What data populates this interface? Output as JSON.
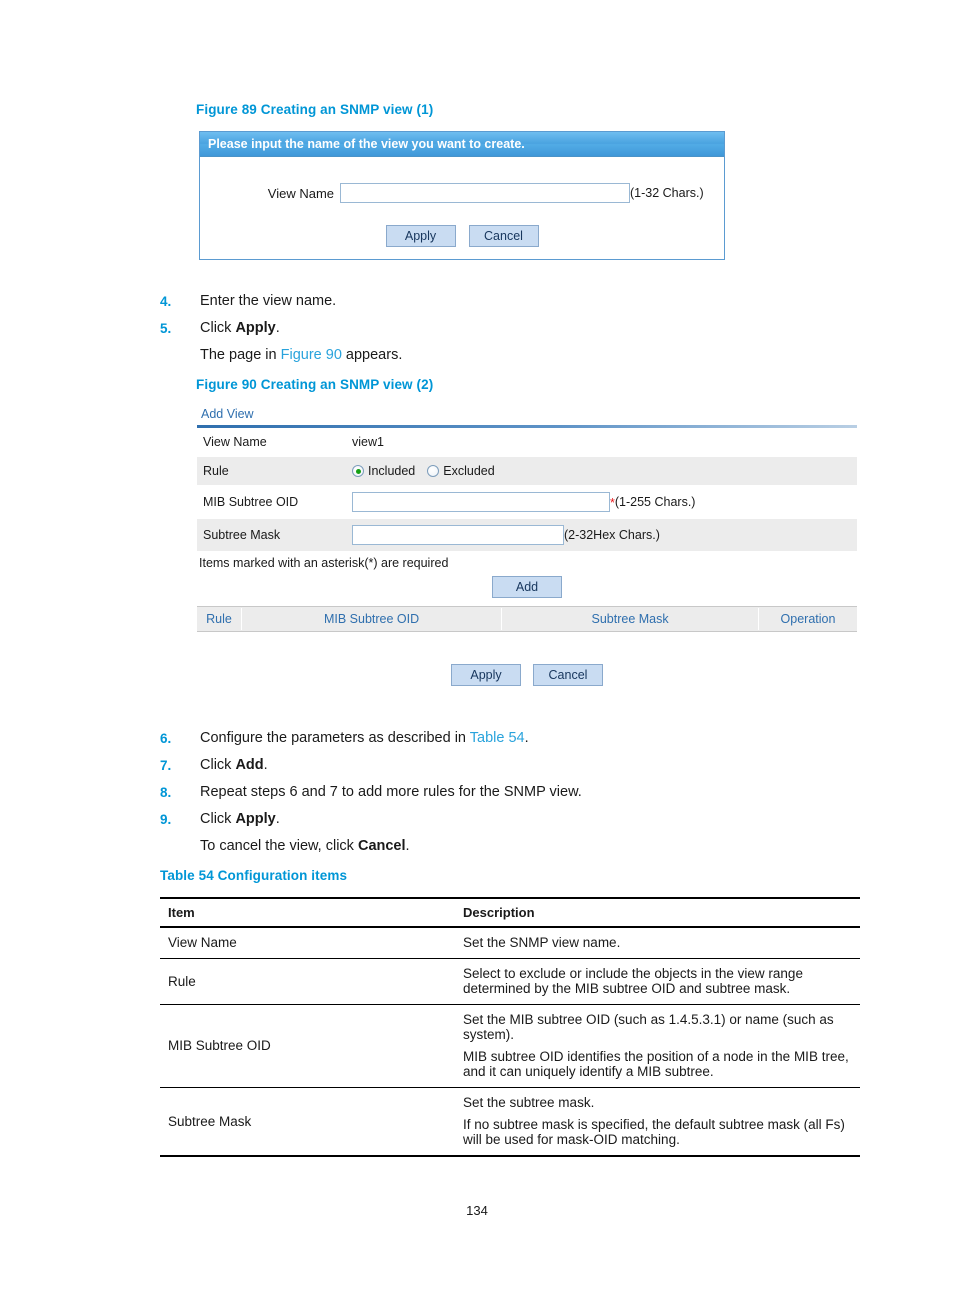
{
  "figure89": {
    "caption": "Figure 89 Creating an SNMP view (1)",
    "dialog": {
      "header": "Please input the name of the view you want to create.",
      "view_name_label": "View Name",
      "view_name_value": "",
      "view_name_hint": "(1-32 Chars.)",
      "apply_label": "Apply",
      "cancel_label": "Cancel"
    }
  },
  "steps_a": [
    {
      "num": "4.",
      "text": "Enter the view name."
    },
    {
      "num": "5.",
      "text": "Click Apply."
    }
  ],
  "steps_a_note_prefix": "The page in ",
  "steps_a_note_link": "Figure 90",
  "steps_a_note_suffix": " appears.",
  "figure90": {
    "caption": "Figure 90 Creating an SNMP view (2)",
    "panel": {
      "tab_label": "Add View",
      "rows": [
        {
          "label": "View Name",
          "value": "view1"
        },
        {
          "label": "Rule"
        },
        {
          "label": "MIB Subtree OID",
          "value": "",
          "hint": "(1-255 Chars.)",
          "required_mark": "*"
        },
        {
          "label": "Subtree Mask",
          "value": "",
          "hint": "(2-32Hex Chars.)"
        }
      ],
      "rule_options": [
        {
          "label": "Included",
          "selected": true
        },
        {
          "label": "Excluded",
          "selected": false
        }
      ],
      "required_note": "Items marked with an asterisk(*) are required",
      "add_label": "Add",
      "list_headers": [
        "Rule",
        "MIB Subtree OID",
        "Subtree Mask",
        "Operation"
      ],
      "apply_label": "Apply",
      "cancel_label": "Cancel"
    }
  },
  "steps_b": [
    {
      "num": "6.",
      "pre": "Configure the parameters as described in ",
      "link": "Table 54",
      "post": "."
    },
    {
      "num": "7.",
      "pre": "Click ",
      "bold": "Add",
      "post": "."
    },
    {
      "num": "8.",
      "pre": "Repeat steps 6 and 7 to add more rules for the SNMP view.",
      "bold": "",
      "post": ""
    },
    {
      "num": "9.",
      "pre": "Click ",
      "bold": "Apply",
      "post": "."
    }
  ],
  "steps_b_note_pre": "To cancel the view, click ",
  "steps_b_note_bold": "Cancel",
  "steps_b_note_post": ".",
  "table54": {
    "caption": "Table 54 Configuration items",
    "headers": [
      "Item",
      "Description"
    ],
    "rows": [
      {
        "item": "View Name",
        "description": [
          "Set the SNMP view name."
        ]
      },
      {
        "item": "Rule",
        "description": [
          "Select to exclude or include the objects in the view range determined by the MIB subtree OID and subtree mask."
        ]
      },
      {
        "item": "MIB Subtree OID",
        "description": [
          "Set the MIB subtree OID (such as 1.4.5.3.1) or name (such as system).",
          "MIB subtree OID identifies the position of a node in the MIB tree, and it can uniquely identify a MIB subtree."
        ]
      },
      {
        "item": "Subtree Mask",
        "description": [
          "Set the subtree mask.",
          "If no subtree mask is specified, the default subtree mask (all Fs) will be used for mask-OID matching."
        ]
      }
    ]
  },
  "footer": {
    "page_number": "134"
  },
  "colors": {
    "accent_blue": "#0096d6",
    "link_blue": "#29a3dc",
    "ui_header_blue": "#4aa3e0",
    "button_fill": "#c9dcf2",
    "required_red": "#e8191c",
    "radio_green": "#15a015"
  }
}
